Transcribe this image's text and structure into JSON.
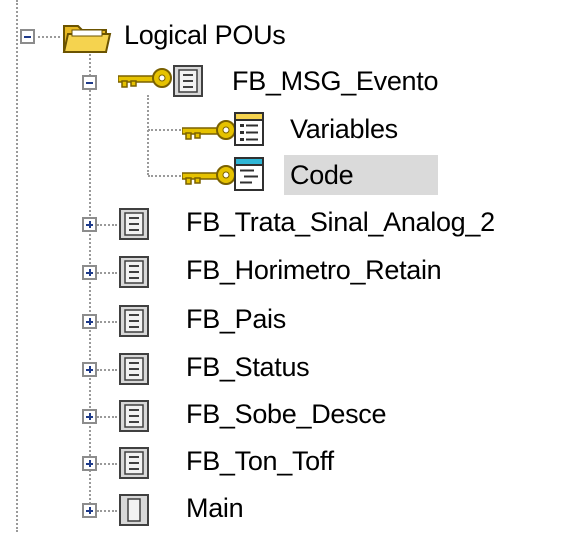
{
  "tree": {
    "root": {
      "label": "Logical POUs",
      "expanded": true,
      "icon": "folder-open-icon"
    },
    "fb_msg_evento": {
      "label": "FB_MSG_Evento",
      "expanded": true,
      "icon": "function-block-icon",
      "badge_icon": "key-icon",
      "children": [
        {
          "label": "Variables",
          "icon": "variables-document-icon",
          "badge_icon": "key-icon"
        },
        {
          "label": "Code",
          "icon": "code-document-icon",
          "badge_icon": "key-icon",
          "selected": true
        }
      ]
    },
    "items": [
      {
        "label": "FB_Trata_Sinal_Analog_2",
        "expanded": false,
        "icon": "function-block-icon"
      },
      {
        "label": "FB_Horimetro_Retain",
        "expanded": false,
        "icon": "function-block-icon"
      },
      {
        "label": "FB_Pais",
        "expanded": false,
        "icon": "function-block-icon"
      },
      {
        "label": "FB_Status",
        "expanded": false,
        "icon": "function-block-icon"
      },
      {
        "label": "FB_Sobe_Desce",
        "expanded": false,
        "icon": "function-block-icon"
      },
      {
        "label": "FB_Ton_Toff",
        "expanded": false,
        "icon": "function-block-icon"
      },
      {
        "label": "Main",
        "expanded": false,
        "icon": "program-icon"
      }
    ]
  },
  "colors": {
    "selection_background": "#dadada",
    "tree_lines": "#9a9a9a",
    "expander_glyph": "#1f3b8a",
    "key_gold": "#e6c200",
    "folder_yellow": "#f5d34f"
  }
}
